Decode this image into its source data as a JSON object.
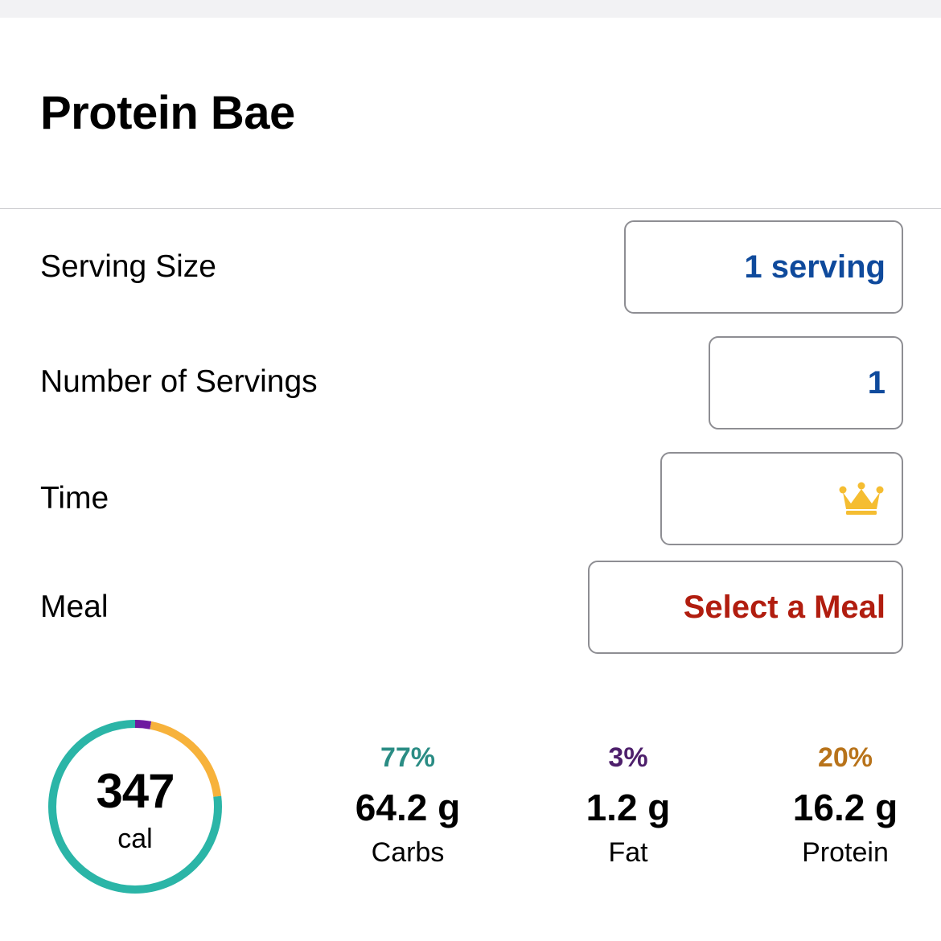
{
  "header": {
    "title": "Protein Bae"
  },
  "form": {
    "serving_size": {
      "label": "Serving Size",
      "value": "1 serving"
    },
    "number_of_servings": {
      "label": "Number of Servings",
      "value": "1"
    },
    "time": {
      "label": "Time",
      "value": "",
      "icon": "crown-icon"
    },
    "meal": {
      "label": "Meal",
      "value": "Select a Meal"
    }
  },
  "summary": {
    "calories": {
      "value": "347",
      "unit": "cal"
    },
    "macros": [
      {
        "percent": "77%",
        "amount": "64.2 g",
        "label": "Carbs",
        "fraction": 0.77,
        "color": "#2bb5a7"
      },
      {
        "percent": "3%",
        "amount": "1.2 g",
        "label": "Fat",
        "fraction": 0.03,
        "color": "#6e1aa0"
      },
      {
        "percent": "20%",
        "amount": "16.2 g",
        "label": "Protein",
        "fraction": 0.2,
        "color": "#f7b23b"
      }
    ]
  },
  "colors": {
    "link_blue": "#0f4a9c",
    "meal_red": "#b11d0f",
    "carbs_text": "#2a8c84",
    "fat_text": "#4d1f6b",
    "protein_text": "#b8731a",
    "crown": "#f5bd31"
  }
}
